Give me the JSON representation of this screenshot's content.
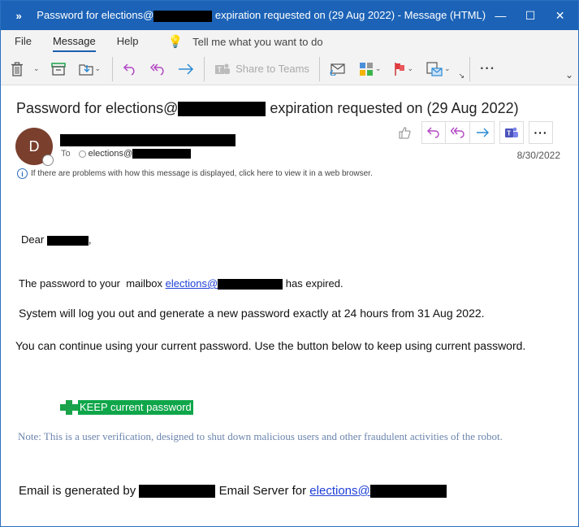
{
  "window": {
    "expand_icon": "double-chevron-right-icon",
    "title_prefix": "Password for elections@",
    "title_suffix": "expiration requested on (29 Aug 2022)  -  Message (HTML)",
    "minimize_icon": "minimize-icon",
    "maximize_icon": "maximize-icon",
    "close_icon": "close-icon"
  },
  "menu": {
    "items": [
      {
        "label": "File",
        "active": false
      },
      {
        "label": "Message",
        "active": true
      },
      {
        "label": "Help",
        "active": false
      }
    ],
    "tell_me": "Tell me what you want to do"
  },
  "toolbar": {
    "buttons": [
      {
        "name": "delete",
        "icon": "trash-icon"
      },
      {
        "name": "archive",
        "icon": "archive-icon"
      },
      {
        "name": "move",
        "icon": "move-to-folder-icon"
      },
      {
        "name": "reply",
        "icon": "reply-icon"
      },
      {
        "name": "reply-all",
        "icon": "reply-all-icon"
      },
      {
        "name": "forward",
        "icon": "forward-icon"
      },
      {
        "name": "read-unread",
        "icon": "envelope-icon"
      },
      {
        "name": "categorize",
        "icon": "categorize-icon"
      },
      {
        "name": "flag",
        "icon": "flag-icon"
      },
      {
        "name": "rules",
        "icon": "rules-icon"
      },
      {
        "name": "more",
        "icon": "more-icon"
      }
    ],
    "share_to_teams": "Share to Teams"
  },
  "message": {
    "subject_prefix": "Password for elections@",
    "subject_suffix": "expiration requested on (29 Aug 2022)",
    "avatar_initial": "D",
    "to_label": "To",
    "to_address": "elections@",
    "date": "8/30/2022",
    "info_bar": "If there are problems with how this message is displayed, click here to view it in a web browser."
  },
  "body": {
    "greeting": "Dear",
    "greeting_suffix": ",",
    "line1_prefix": "The password to your  mailbox ",
    "line1_link": "elections@",
    "line1_suffix": "has expired.",
    "line2": "System will log you out and generate a new password exactly at 24 hours from 31 Aug 2022.",
    "line3": "You can continue using your current password. Use the button below to keep using current password.",
    "keep_button": "KEEP current password",
    "note": "Note: This is a user verification, designed to shut down malicious users and other fraudulent activities of the robot.",
    "footer_prefix": "Email is generated by",
    "footer_middle": "Email Server for",
    "footer_link": "elections@"
  },
  "colors": {
    "titlebar": "#1c63b7",
    "avatar": "#7a3f2d",
    "keep_button": "#0fa64a",
    "note": "#6b85ad",
    "reply_purple": "#b146c2",
    "forward_blue": "#2a8ad4",
    "flag_red": "#e03a3e"
  }
}
